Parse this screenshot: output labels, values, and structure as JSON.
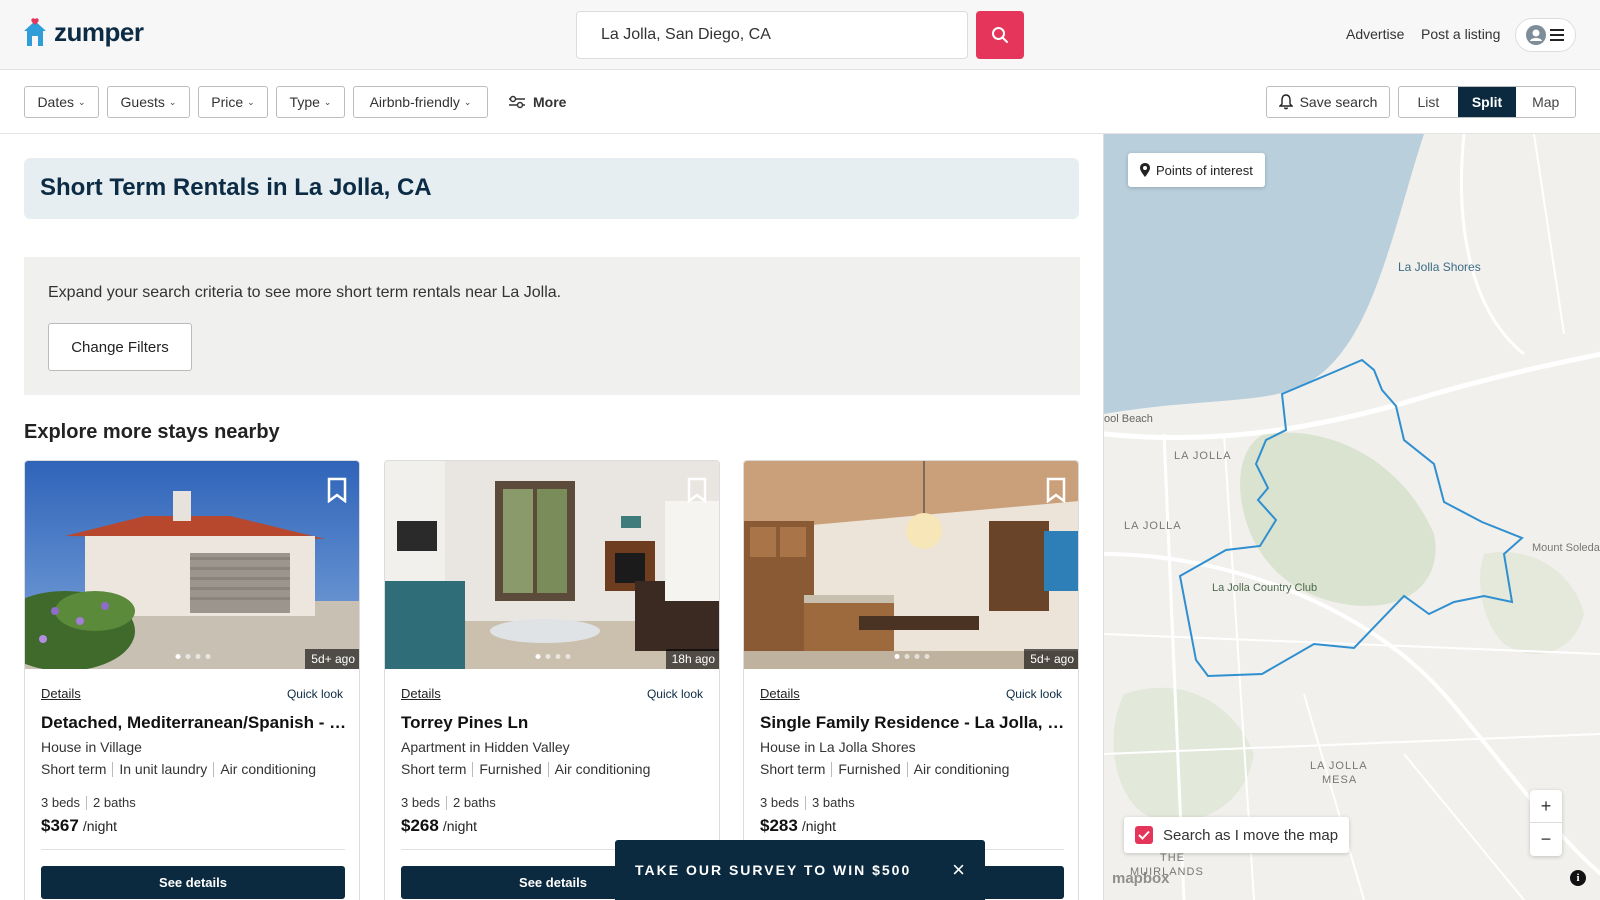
{
  "header": {
    "logo_text": "zumper",
    "search_value": "La Jolla, San Diego, CA",
    "advertise": "Advertise",
    "post_listing": "Post a listing"
  },
  "filters": {
    "dates": "Dates",
    "guests": "Guests",
    "price": "Price",
    "type": "Type",
    "airbnb": "Airbnb-friendly",
    "more": "More",
    "save_search": "Save search",
    "view_list": "List",
    "view_split": "Split",
    "view_map": "Map"
  },
  "main": {
    "title": "Short Term Rentals in La Jolla, CA",
    "expand_text": "Expand your search criteria to see more short term rentals near La Jolla.",
    "change_filters": "Change Filters",
    "explore_heading": "Explore more stays nearby"
  },
  "cards": [
    {
      "age": "5d+ ago",
      "details": "Details",
      "quick_look": "Quick look",
      "title": "Detached, Mediterranean/Spanish - La Jolla, CA",
      "subtitle": "House in Village",
      "tags": [
        "Short term",
        "In unit laundry",
        "Air conditioning"
      ],
      "beds": "3 beds",
      "baths": "2 baths",
      "price": "$367",
      "per_night": "/night",
      "cta": "See details"
    },
    {
      "age": "18h ago",
      "details": "Details",
      "quick_look": "Quick look",
      "title": "Torrey Pines Ln",
      "subtitle": "Apartment in Hidden Valley",
      "tags": [
        "Short term",
        "Furnished",
        "Air conditioning"
      ],
      "beds": "3 beds",
      "baths": "2 baths",
      "price": "$268",
      "per_night": "/night",
      "cta": "See details"
    },
    {
      "age": "5d+ ago",
      "details": "Details",
      "quick_look": "Quick look",
      "title": "Single Family Residence - La Jolla, CA",
      "subtitle": "House in La Jolla Shores",
      "tags": [
        "Short term",
        "Furnished",
        "Air conditioning"
      ],
      "beds": "3 beds",
      "baths": "3 baths",
      "price": "$283",
      "per_night": "/night",
      "cta": "See details"
    }
  ],
  "survey": {
    "text": "TAKE OUR SURVEY TO WIN $500",
    "close": "×"
  },
  "map": {
    "poi": "Points of interest",
    "labels": {
      "la_jolla_shores": "La Jolla Shores",
      "pool_beach": "ool Beach",
      "la_jolla_1": "LA JOLLA",
      "la_jolla_2": "LA JOLLA",
      "country_club": "La Jolla Country Club",
      "mount_soledad": "Mount Soleda",
      "la_jolla_mesa_1": "LA JOLLA",
      "la_jolla_mesa_2": "MESA",
      "muirlands_1": "THE",
      "muirlands_2": "MUIRLANDS"
    },
    "zoom_in": "+",
    "zoom_out": "−",
    "search_move": "Search as I move the map",
    "search_move_checked": true,
    "attribution": "mapbox",
    "info": "i"
  },
  "colors": {
    "brand_pink": "#e5355a",
    "navy": "#0b2a3f",
    "boundary": "#2f8fd0"
  }
}
